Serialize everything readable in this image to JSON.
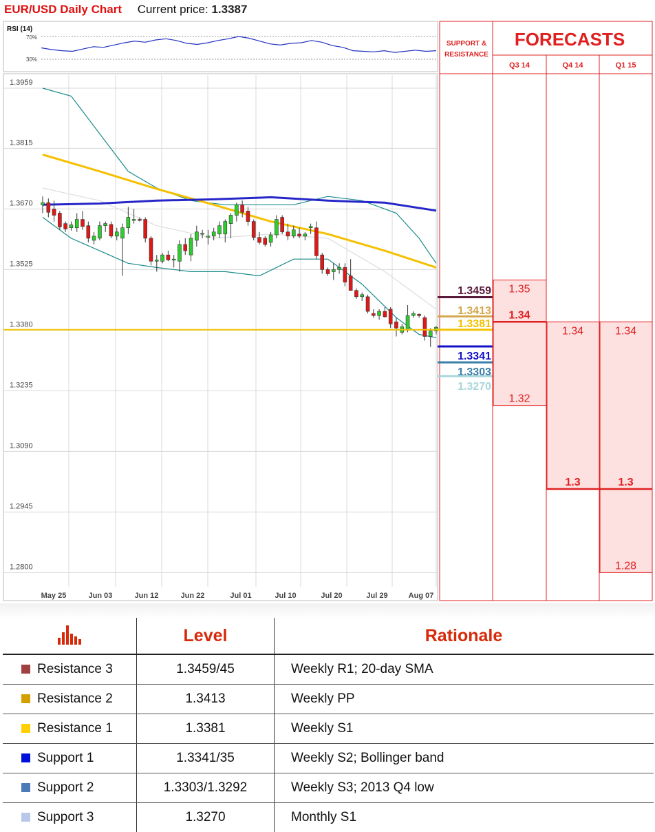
{
  "header": {
    "title": "EUR/USD Daily Chart",
    "current_price_label": "Current price:",
    "current_price": "1.3387"
  },
  "rsi": {
    "label": "RSI (14)",
    "upper_label": "70%",
    "lower_label": "30%"
  },
  "chart_data": {
    "type": "candlestick",
    "title": "EUR/USD Daily Chart",
    "y_ticks": [
      "1.3959",
      "1.3815",
      "1.3670",
      "1.3525",
      "1.3380",
      "1.3235",
      "1.3090",
      "1.2945",
      "1.2800"
    ],
    "ylim": [
      1.276,
      1.3959
    ],
    "x_ticks": [
      "May 25",
      "Jun 03",
      "Jun 12",
      "Jun 22",
      "Jul 01",
      "Jul 10",
      "Jul 20",
      "Jul 29",
      "Aug 07"
    ],
    "candles": [
      {
        "o": 1.368,
        "h": 1.37,
        "l": 1.366,
        "c": 1.3685
      },
      {
        "o": 1.3685,
        "h": 1.3695,
        "l": 1.365,
        "c": 1.3662
      },
      {
        "o": 1.367,
        "h": 1.369,
        "l": 1.364,
        "c": 1.3655
      },
      {
        "o": 1.366,
        "h": 1.3665,
        "l": 1.362,
        "c": 1.3627
      },
      {
        "o": 1.3635,
        "h": 1.364,
        "l": 1.3615,
        "c": 1.3622
      },
      {
        "o": 1.3625,
        "h": 1.364,
        "l": 1.3618,
        "c": 1.3632
      },
      {
        "o": 1.3625,
        "h": 1.366,
        "l": 1.3615,
        "c": 1.3645
      },
      {
        "o": 1.3645,
        "h": 1.3665,
        "l": 1.362,
        "c": 1.3628
      },
      {
        "o": 1.363,
        "h": 1.364,
        "l": 1.359,
        "c": 1.36
      },
      {
        "o": 1.3595,
        "h": 1.3615,
        "l": 1.3585,
        "c": 1.3605
      },
      {
        "o": 1.36,
        "h": 1.364,
        "l": 1.3595,
        "c": 1.363
      },
      {
        "o": 1.363,
        "h": 1.364,
        "l": 1.3615,
        "c": 1.3635
      },
      {
        "o": 1.3633,
        "h": 1.364,
        "l": 1.36,
        "c": 1.3605
      },
      {
        "o": 1.3605,
        "h": 1.3625,
        "l": 1.3595,
        "c": 1.3615
      },
      {
        "o": 1.36,
        "h": 1.3635,
        "l": 1.351,
        "c": 1.3625
      },
      {
        "o": 1.3625,
        "h": 1.3675,
        "l": 1.361,
        "c": 1.365
      },
      {
        "o": 1.3645,
        "h": 1.367,
        "l": 1.3635,
        "c": 1.3645
      },
      {
        "o": 1.3645,
        "h": 1.365,
        "l": 1.364,
        "c": 1.3643
      },
      {
        "o": 1.3645,
        "h": 1.365,
        "l": 1.359,
        "c": 1.36
      },
      {
        "o": 1.36,
        "h": 1.3605,
        "l": 1.3535,
        "c": 1.3545
      },
      {
        "o": 1.3545,
        "h": 1.356,
        "l": 1.352,
        "c": 1.3548
      },
      {
        "o": 1.3545,
        "h": 1.3565,
        "l": 1.354,
        "c": 1.356
      },
      {
        "o": 1.356,
        "h": 1.357,
        "l": 1.3545,
        "c": 1.3548
      },
      {
        "o": 1.3548,
        "h": 1.356,
        "l": 1.353,
        "c": 1.355
      },
      {
        "o": 1.3545,
        "h": 1.3595,
        "l": 1.352,
        "c": 1.3585
      },
      {
        "o": 1.3585,
        "h": 1.36,
        "l": 1.356,
        "c": 1.357
      },
      {
        "o": 1.356,
        "h": 1.361,
        "l": 1.3545,
        "c": 1.36
      },
      {
        "o": 1.3595,
        "h": 1.363,
        "l": 1.358,
        "c": 1.3615
      },
      {
        "o": 1.361,
        "h": 1.362,
        "l": 1.36,
        "c": 1.3612
      },
      {
        "o": 1.3605,
        "h": 1.362,
        "l": 1.3585,
        "c": 1.3605
      },
      {
        "o": 1.3605,
        "h": 1.3625,
        "l": 1.3595,
        "c": 1.3615
      },
      {
        "o": 1.361,
        "h": 1.364,
        "l": 1.36,
        "c": 1.363
      },
      {
        "o": 1.361,
        "h": 1.3645,
        "l": 1.359,
        "c": 1.364
      },
      {
        "o": 1.3635,
        "h": 1.366,
        "l": 1.36,
        "c": 1.3655
      },
      {
        "o": 1.3655,
        "h": 1.3685,
        "l": 1.364,
        "c": 1.368
      },
      {
        "o": 1.368,
        "h": 1.369,
        "l": 1.365,
        "c": 1.3662
      },
      {
        "o": 1.3665,
        "h": 1.3675,
        "l": 1.363,
        "c": 1.364
      },
      {
        "o": 1.364,
        "h": 1.3645,
        "l": 1.3595,
        "c": 1.3602
      },
      {
        "o": 1.3602,
        "h": 1.3615,
        "l": 1.3585,
        "c": 1.359
      },
      {
        "o": 1.36,
        "h": 1.3605,
        "l": 1.358,
        "c": 1.3585
      },
      {
        "o": 1.359,
        "h": 1.3615,
        "l": 1.358,
        "c": 1.3608
      },
      {
        "o": 1.3608,
        "h": 1.3655,
        "l": 1.36,
        "c": 1.3645
      },
      {
        "o": 1.365,
        "h": 1.3655,
        "l": 1.361,
        "c": 1.3615
      },
      {
        "o": 1.3615,
        "h": 1.3635,
        "l": 1.3595,
        "c": 1.3605
      },
      {
        "o": 1.3605,
        "h": 1.363,
        "l": 1.36,
        "c": 1.362
      },
      {
        "o": 1.361,
        "h": 1.3625,
        "l": 1.36,
        "c": 1.3605
      },
      {
        "o": 1.3605,
        "h": 1.3615,
        "l": 1.3595,
        "c": 1.361
      },
      {
        "o": 1.3625,
        "h": 1.3635,
        "l": 1.361,
        "c": 1.3628
      },
      {
        "o": 1.3625,
        "h": 1.364,
        "l": 1.355,
        "c": 1.3558
      },
      {
        "o": 1.356,
        "h": 1.3565,
        "l": 1.3515,
        "c": 1.3525
      },
      {
        "o": 1.3525,
        "h": 1.353,
        "l": 1.351,
        "c": 1.3515
      },
      {
        "o": 1.352,
        "h": 1.354,
        "l": 1.35,
        "c": 1.3525
      },
      {
        "o": 1.3525,
        "h": 1.354,
        "l": 1.3515,
        "c": 1.353
      },
      {
        "o": 1.353,
        "h": 1.354,
        "l": 1.3485,
        "c": 1.3495
      },
      {
        "o": 1.351,
        "h": 1.355,
        "l": 1.3475,
        "c": 1.3475
      },
      {
        "o": 1.3475,
        "h": 1.348,
        "l": 1.3455,
        "c": 1.346
      },
      {
        "o": 1.346,
        "h": 1.347,
        "l": 1.345,
        "c": 1.3465
      },
      {
        "o": 1.346,
        "h": 1.3465,
        "l": 1.342,
        "c": 1.3425
      },
      {
        "o": 1.342,
        "h": 1.343,
        "l": 1.341,
        "c": 1.3415
      },
      {
        "o": 1.3415,
        "h": 1.343,
        "l": 1.3405,
        "c": 1.3425
      },
      {
        "o": 1.3425,
        "h": 1.3435,
        "l": 1.341,
        "c": 1.3412
      },
      {
        "o": 1.343,
        "h": 1.3435,
        "l": 1.3385,
        "c": 1.3395
      },
      {
        "o": 1.34,
        "h": 1.341,
        "l": 1.3365,
        "c": 1.3385
      },
      {
        "o": 1.3375,
        "h": 1.3395,
        "l": 1.337,
        "c": 1.3388
      },
      {
        "o": 1.338,
        "h": 1.344,
        "l": 1.3375,
        "c": 1.3415
      },
      {
        "o": 1.3415,
        "h": 1.3425,
        "l": 1.341,
        "c": 1.342
      },
      {
        "o": 1.3418,
        "h": 1.342,
        "l": 1.341,
        "c": 1.3415
      },
      {
        "o": 1.341,
        "h": 1.3415,
        "l": 1.3355,
        "c": 1.3365
      },
      {
        "o": 1.3365,
        "h": 1.3385,
        "l": 1.334,
        "c": 1.3378
      },
      {
        "o": 1.3378,
        "h": 1.339,
        "l": 1.337,
        "c": 1.3387
      }
    ],
    "ma_blue": [
      [
        0,
        1.368
      ],
      [
        10,
        1.3683
      ],
      [
        20,
        1.369
      ],
      [
        30,
        1.3693
      ],
      [
        40,
        1.3698
      ],
      [
        50,
        1.369
      ],
      [
        60,
        1.3685
      ],
      [
        69,
        1.3666
      ]
    ],
    "ma_yellow": [
      [
        0,
        1.38
      ],
      [
        10,
        1.376
      ],
      [
        20,
        1.3718
      ],
      [
        30,
        1.368
      ],
      [
        40,
        1.364
      ],
      [
        50,
        1.361
      ],
      [
        60,
        1.357
      ],
      [
        69,
        1.353
      ]
    ],
    "boll_upper": [
      [
        0,
        1.3959
      ],
      [
        5,
        1.394
      ],
      [
        10,
        1.385
      ],
      [
        15,
        1.376
      ],
      [
        20,
        1.372
      ],
      [
        26,
        1.369
      ],
      [
        32,
        1.368
      ],
      [
        38,
        1.368
      ],
      [
        44,
        1.368
      ],
      [
        50,
        1.37
      ],
      [
        56,
        1.369
      ],
      [
        62,
        1.366
      ],
      [
        66,
        1.36
      ],
      [
        69,
        1.354
      ]
    ],
    "boll_lower": [
      [
        0,
        1.365
      ],
      [
        5,
        1.36
      ],
      [
        10,
        1.357
      ],
      [
        15,
        1.354
      ],
      [
        20,
        1.353
      ],
      [
        26,
        1.352
      ],
      [
        32,
        1.352
      ],
      [
        38,
        1.351
      ],
      [
        44,
        1.355
      ],
      [
        50,
        1.355
      ],
      [
        56,
        1.349
      ],
      [
        62,
        1.341
      ],
      [
        66,
        1.337
      ],
      [
        69,
        1.3362
      ]
    ],
    "ma_gray": [
      [
        0,
        1.372
      ],
      [
        10,
        1.369
      ],
      [
        20,
        1.363
      ],
      [
        30,
        1.36
      ],
      [
        40,
        1.361
      ],
      [
        50,
        1.36
      ],
      [
        60,
        1.352
      ],
      [
        69,
        1.343
      ]
    ],
    "rsi_values": [
      50,
      47,
      45,
      44,
      48,
      52,
      51,
      55,
      59,
      62,
      60,
      64,
      66,
      63,
      58,
      56,
      59,
      63,
      66,
      70,
      67,
      62,
      57,
      55,
      58,
      59,
      63,
      60,
      54,
      51,
      45,
      44,
      43,
      45,
      42,
      44,
      46,
      44,
      45
    ]
  },
  "sr": {
    "header": "SUPPORT & RESISTANCE",
    "levels": [
      {
        "value": 1.3459,
        "label": "1.3459",
        "color": "#5b1a3c"
      },
      {
        "value": 1.3413,
        "label": "1.3413",
        "color": "#d4a84b"
      },
      {
        "value": 1.3381,
        "label": "1.3381",
        "color": "#f2c200"
      },
      {
        "value": 1.3341,
        "label": "1.3341",
        "color": "#1010c8"
      },
      {
        "value": 1.3303,
        "label": "1.3303",
        "color": "#3a7fa8"
      },
      {
        "value": 1.327,
        "label": "1.3270",
        "color": "#a8d6da"
      }
    ]
  },
  "forecasts": {
    "title": "FORECASTS",
    "columns": [
      {
        "name": "Q3 14",
        "high": 1.35,
        "high_label": "1.35",
        "mid": 1.34,
        "mid_label": "1.34",
        "low": 1.32,
        "low_label": "1.32"
      },
      {
        "name": "Q4 14",
        "high": 1.34,
        "high_label": "1.34",
        "mid": 1.3,
        "mid_label": "1.3",
        "low": 1.3,
        "low_label": ""
      },
      {
        "name": "Q1 15",
        "high": 1.34,
        "high_label": "1.34",
        "mid": 1.3,
        "mid_label": "1.3",
        "low": 1.28,
        "low_label": "1.28"
      }
    ]
  },
  "table": {
    "headers": {
      "level": "Level",
      "rationale": "Rationale"
    },
    "icon": "bar-chart-icon",
    "rows": [
      {
        "name": "Resistance 3",
        "level": "1.3459/45",
        "rationale": "Weekly R1; 20-day SMA",
        "color": "#a04040"
      },
      {
        "name": "Resistance 2",
        "level": "1.3413",
        "rationale": "Weekly PP",
        "color": "#d4a000"
      },
      {
        "name": "Resistance 1",
        "level": "1.3381",
        "rationale": "Weekly S1",
        "color": "#ffd000"
      },
      {
        "name": "Support 1",
        "level": "1.3341/35",
        "rationale": "Weekly S2; Bollinger band",
        "color": "#0010d8"
      },
      {
        "name": "Support 2",
        "level": "1.3303/1.3292",
        "rationale": "Weekly S3; 2013 Q4 low",
        "color": "#4a7ab8"
      },
      {
        "name": "Support 3",
        "level": "1.3270",
        "rationale": "Monthly S1",
        "color": "#b8c8e8"
      }
    ]
  }
}
